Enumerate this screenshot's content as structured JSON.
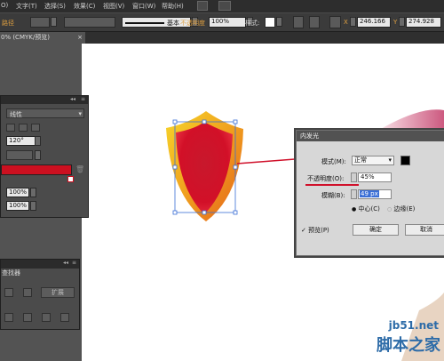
{
  "menu": {
    "items": [
      "O)",
      "文字(T)",
      "选择(S)",
      "效果(C)",
      "视图(V)",
      "窗口(W)",
      "帮助(H)"
    ]
  },
  "control_bar": {
    "label_left": "路径",
    "stroke_style": "基本",
    "opacity_label": "不透明度",
    "opacity_value": "100%",
    "style_label": "样式:",
    "x_label": "X",
    "x_value": "246.166",
    "y_label": "Y",
    "y_value": "274.928"
  },
  "document_tab": {
    "title": "0% (CMYK/预览)"
  },
  "left_panel": {
    "dropdown_value": "线性",
    "angle_value": "120°",
    "percent_1": "100%",
    "percent_2": "100%"
  },
  "bottom_panel": {
    "title": "查找器",
    "action_label": "扩展"
  },
  "dialog": {
    "title": "内发光",
    "mode_label": "模式(M):",
    "mode_value": "正常",
    "opacity_label": "不透明度(O):",
    "opacity_value": "45%",
    "blur_label": "模糊(B):",
    "blur_value": "49 px",
    "center_label": "中心(C)",
    "edge_label": "边缘(E)",
    "preview_label": "预览(P)",
    "ok_label": "确定",
    "cancel_label": "取消"
  },
  "watermark": {
    "site": "jb51.net",
    "name": "脚本之家"
  },
  "colors": {
    "shield_red": "#d0112b",
    "shield_orange": "#f0a01e",
    "swatch_red": "#cc1020",
    "selection_blue": "#3b6fd6"
  }
}
